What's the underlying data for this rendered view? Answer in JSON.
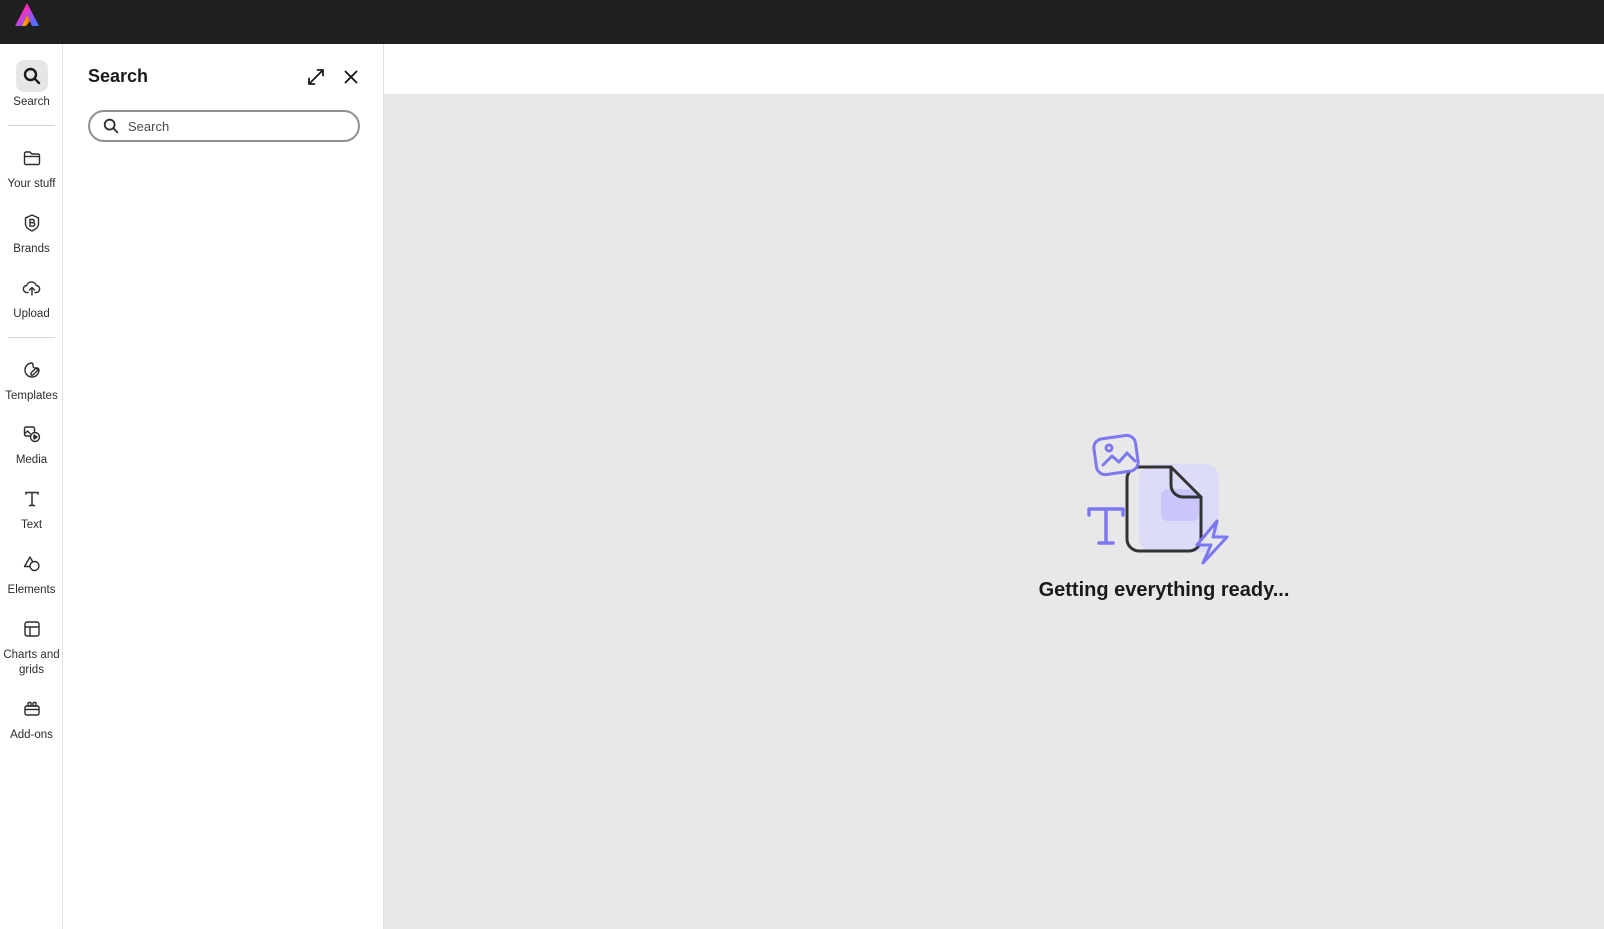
{
  "app": {
    "logo_icon": "adobe-express-logo"
  },
  "rail": {
    "items": [
      {
        "id": "search",
        "label": "Search",
        "icon": "search-icon",
        "active": true
      },
      {
        "id": "your-stuff",
        "label": "Your stuff",
        "icon": "folder-icon"
      },
      {
        "id": "brands",
        "label": "Brands",
        "icon": "brand-icon"
      },
      {
        "id": "upload",
        "label": "Upload",
        "icon": "cloud-upload-icon"
      },
      {
        "id": "templates",
        "label": "Templates",
        "icon": "templates-icon"
      },
      {
        "id": "media",
        "label": "Media",
        "icon": "media-icon"
      },
      {
        "id": "text",
        "label": "Text",
        "icon": "text-icon"
      },
      {
        "id": "elements",
        "label": "Elements",
        "icon": "elements-icon"
      },
      {
        "id": "charts-and-grids",
        "label": "Charts and grids",
        "icon": "grid-icon"
      },
      {
        "id": "add-ons",
        "label": "Add-ons",
        "icon": "add-ons-icon"
      }
    ]
  },
  "panel": {
    "title": "Search",
    "search_placeholder": "Search",
    "expand_icon": "expand-icon",
    "close_icon": "close-icon"
  },
  "canvas": {
    "loading_text": "Getting everything ready...",
    "accent_color": "#7b78f0",
    "background_color": "#e8e8e8"
  }
}
